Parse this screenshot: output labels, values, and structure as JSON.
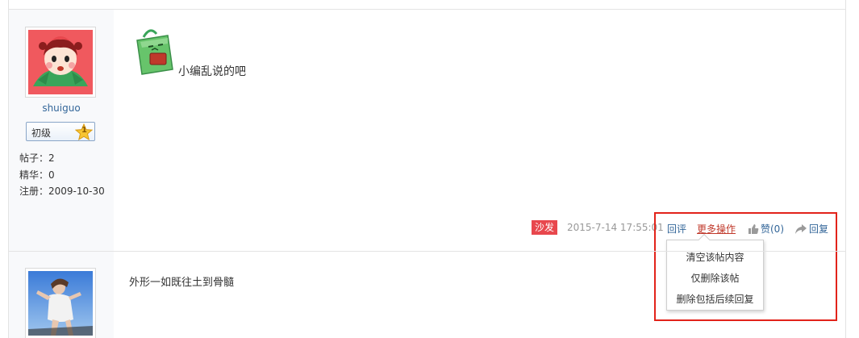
{
  "post1": {
    "username": "shuiguo",
    "rank_label": "初级",
    "rank_level": "1",
    "stats": {
      "posts": "帖子：2",
      "essence": "精华：0",
      "registered": "注册：2009-10-30"
    },
    "content": "小编乱说的吧",
    "floor_badge": "沙发",
    "time": "2015-7-14 17:55:01",
    "actions": {
      "reply_comment": "回评",
      "more": "更多操作",
      "like": "赞(0)",
      "reply": "回复"
    },
    "dropdown": {
      "items": [
        "清空该帖内容",
        "仅删除该帖",
        "删除包括后续回复"
      ]
    }
  },
  "post2": {
    "content": "外形一如既往土到骨髓"
  },
  "colors": {
    "accent_red": "#e2231a",
    "link_blue": "#336699",
    "badge_red": "#e8474d"
  }
}
